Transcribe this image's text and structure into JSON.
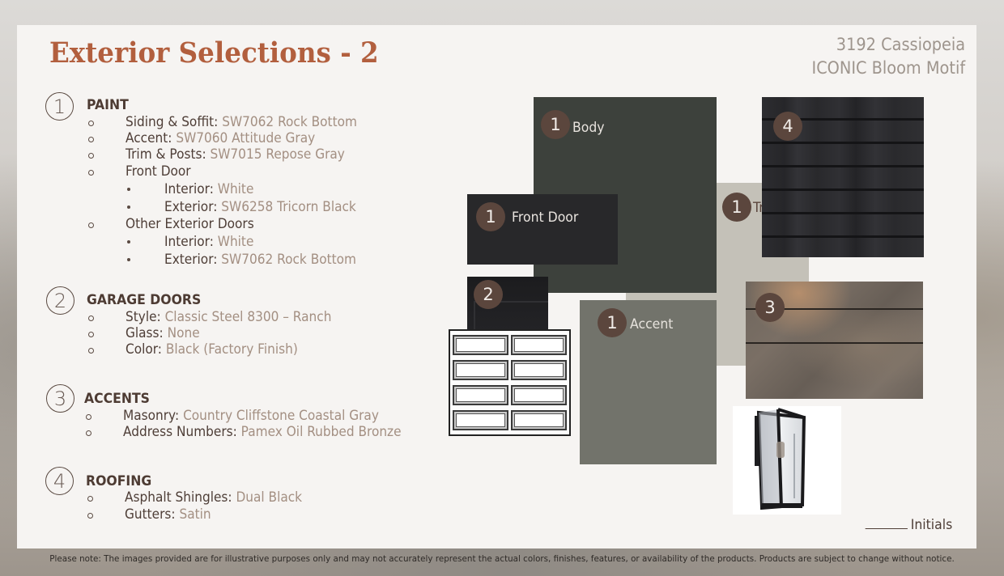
{
  "header": {
    "title": "Exterior Selections - 2",
    "project_line1": "3192 Cassiopeia",
    "project_line2": "ICONIC Bloom Motif"
  },
  "sections": [
    {
      "number": "1",
      "heading": "PAINT",
      "items": [
        {
          "level": 1,
          "label": "Siding & Soffit: ",
          "value": "SW7062 Rock Bottom"
        },
        {
          "level": 1,
          "label": "Accent: ",
          "value": "SW7060 Attitude Gray"
        },
        {
          "level": 1,
          "label": "Trim & Posts: ",
          "value": "SW7015 Repose Gray"
        },
        {
          "level": 1,
          "label": "Front Door",
          "value": ""
        },
        {
          "level": 2,
          "label": "Interior: ",
          "value": "White"
        },
        {
          "level": 2,
          "label": "Exterior: ",
          "value": "SW6258 Tricorn Black"
        },
        {
          "level": 1,
          "label": "Other Exterior Doors",
          "value": ""
        },
        {
          "level": 2,
          "label": "Interior: ",
          "value": "White"
        },
        {
          "level": 2,
          "label": "Exterior: ",
          "value": "SW7062 Rock Bottom"
        }
      ]
    },
    {
      "number": "2",
      "heading": "GARAGE DOORS",
      "items": [
        {
          "level": 1,
          "label": "Style: ",
          "value": "Classic Steel 8300 – Ranch"
        },
        {
          "level": 1,
          "label": "Glass: ",
          "value": "None"
        },
        {
          "level": 1,
          "label": "Color: ",
          "value": "Black (Factory Finish)"
        }
      ]
    },
    {
      "number": "3",
      "heading": "ACCENTS",
      "items": [
        {
          "level": 1,
          "label": "Masonry: ",
          "value": "Country Cliffstone Coastal Gray"
        },
        {
          "level": 1,
          "label": "Address Numbers: ",
          "value": "Pamex Oil Rubbed Bronze"
        }
      ]
    },
    {
      "number": "4",
      "heading": "ROOFING",
      "items": [
        {
          "level": 1,
          "label": "Asphalt Shingles: ",
          "value": "Dual Black"
        },
        {
          "level": 1,
          "label": "Gutters: ",
          "value": "Satin"
        }
      ]
    }
  ],
  "swatches": {
    "body": {
      "badge": "1",
      "label": "Body",
      "color": "#3d413c"
    },
    "front_door": {
      "badge": "1",
      "label": "Front Door",
      "color": "#28282a"
    },
    "trim": {
      "badge": "1",
      "label": "Trim",
      "color": "#c4c1b8"
    },
    "accent": {
      "badge": "1",
      "label": "Accent",
      "color": "#72736b"
    },
    "roofing": {
      "badge": "4"
    },
    "masonry": {
      "badge": "3"
    },
    "garage": {
      "badge": "2"
    },
    "lantern": {
      "icon": "wall-lantern-image"
    }
  },
  "colors": {
    "title": "#b25f3e",
    "value_text": "#a38f82",
    "label_text": "#4e3e37",
    "badge": "#5b463d",
    "slide_bg": "#f6f4f2"
  },
  "signoff": {
    "initials_label": "Initials"
  },
  "disclaimer": "Please note: The images provided are for illustrative purposes only and may not accurately represent the actual colors, finishes, features, or availability of the products. Products are subject to change without notice."
}
